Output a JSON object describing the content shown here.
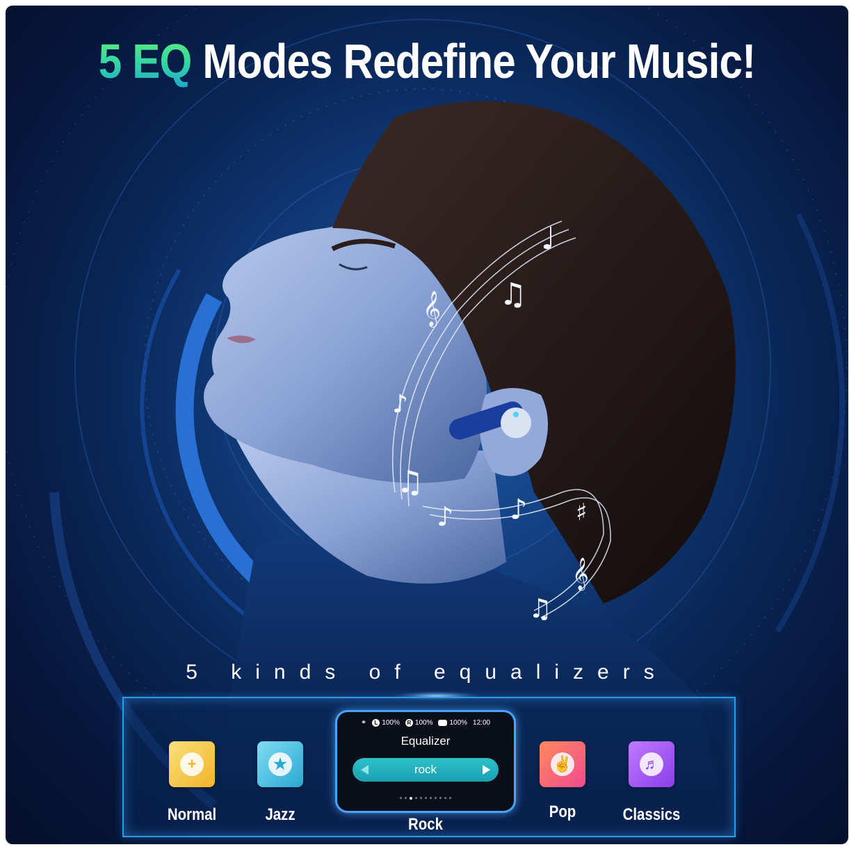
{
  "headline": {
    "highlight": "5 EQ",
    "rest": "Modes Redefine Your Music!"
  },
  "subtitle": "5 kinds of equalizers",
  "colors": {
    "accent_green": "#5cf07a",
    "panel_border": "#2f9be6",
    "background_dark": "#06163a"
  },
  "modes": [
    {
      "label": "Normal",
      "icon": "plus-icon",
      "color": "#f6d04a"
    },
    {
      "label": "Jazz",
      "icon": "star-icon",
      "color": "#54c7e6"
    },
    {
      "label": "Pop",
      "icon": "rock-hand-icon",
      "color": "#f25c93"
    },
    {
      "label": "Classics",
      "icon": "guitar-icon",
      "color": "#a55bf0"
    }
  ],
  "device_screen": {
    "status": {
      "left_battery": "100%",
      "left_badge": "L",
      "right_battery": "100%",
      "right_badge": "R",
      "case_battery": "100%",
      "time": "12:00"
    },
    "title": "Equalizer",
    "selected_value": "rock",
    "page_count": 11,
    "active_page": 3
  },
  "selected_mode_label": "Rock",
  "images": {
    "main": "man-with-earbud-music-notes"
  }
}
